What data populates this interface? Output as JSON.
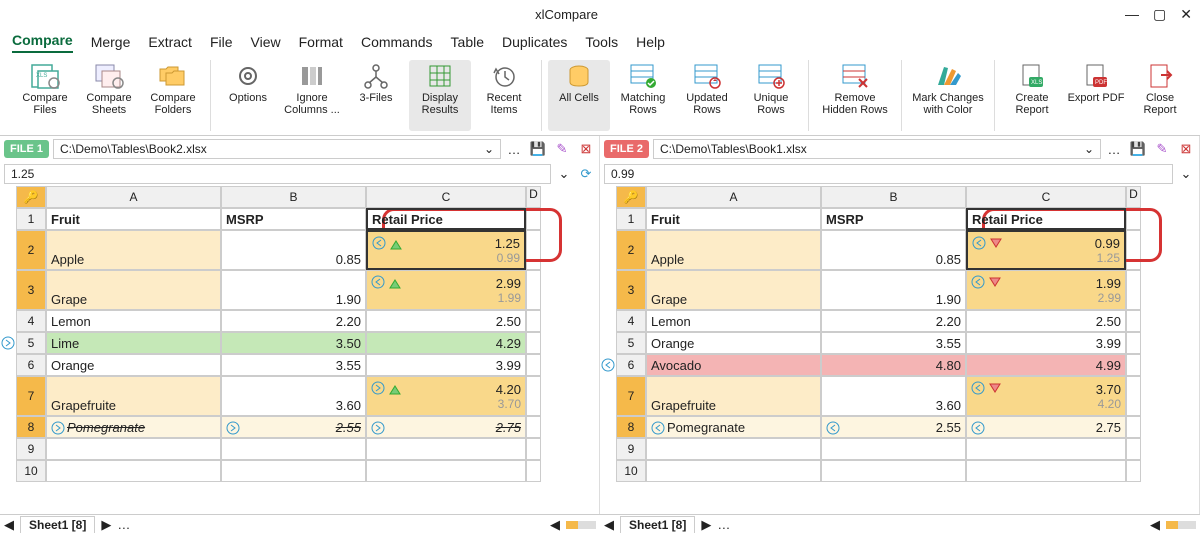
{
  "app_title": "xlCompare",
  "menu": [
    "Compare",
    "Merge",
    "Extract",
    "File",
    "View",
    "Format",
    "Commands",
    "Table",
    "Duplicates",
    "Tools",
    "Help"
  ],
  "ribbon": [
    {
      "key": "compare-files",
      "label": "Compare Files"
    },
    {
      "key": "compare-sheets",
      "label": "Compare Sheets"
    },
    {
      "key": "compare-folders",
      "label": "Compare Folders"
    },
    {
      "key": "options",
      "label": "Options"
    },
    {
      "key": "ignore-columns",
      "label": "Ignore Columns ..."
    },
    {
      "key": "three-files",
      "label": "3-Files"
    },
    {
      "key": "display-results",
      "label": "Display Results"
    },
    {
      "key": "recent-items",
      "label": "Recent Items"
    },
    {
      "key": "all-cells",
      "label": "All Cells"
    },
    {
      "key": "matching-rows",
      "label": "Matching Rows"
    },
    {
      "key": "updated-rows",
      "label": "Updated Rows"
    },
    {
      "key": "unique-rows",
      "label": "Unique Rows"
    },
    {
      "key": "remove-hidden",
      "label": "Remove Hidden Rows"
    },
    {
      "key": "mark-changes",
      "label": "Mark Changes with Color"
    },
    {
      "key": "create-report",
      "label": "Create Report"
    },
    {
      "key": "export-pdf",
      "label": "Export PDF"
    },
    {
      "key": "close-report",
      "label": "Close Report"
    }
  ],
  "left": {
    "badge": "FILE 1",
    "path": "C:\\Demo\\Tables\\Book2.xlsx",
    "formula": "1.25",
    "columns": [
      "A",
      "B",
      "C",
      "D"
    ],
    "headers": {
      "A": "Fruit",
      "B": "MSRP",
      "C": "Retail Price"
    },
    "rows": [
      {
        "n": 2,
        "A": "Apple",
        "B": "0.85",
        "C_new": "1.25",
        "C_old": "0.99",
        "changed": true,
        "diff": "up"
      },
      {
        "n": 3,
        "A": "Grape",
        "B": "1.90",
        "C_new": "2.99",
        "C_old": "1.99",
        "changed": true,
        "diff": "up"
      },
      {
        "n": 4,
        "A": "Lemon",
        "B": "2.20",
        "C": "2.50"
      },
      {
        "n": 5,
        "A": "Lime",
        "B": "3.50",
        "C": "4.29",
        "added": true
      },
      {
        "n": 6,
        "A": "Orange",
        "B": "3.55",
        "C": "3.99"
      },
      {
        "n": 7,
        "A": "Grapefruite",
        "B": "3.60",
        "C_new": "4.20",
        "C_old": "3.70",
        "changed": true,
        "diff": "up"
      },
      {
        "n": 8,
        "A": "Pomegranate",
        "B": "2.55",
        "C": "2.75",
        "strike": true,
        "changed": true
      },
      {
        "n": 9,
        "A": "",
        "B": "",
        "C": ""
      },
      {
        "n": 10,
        "A": "",
        "B": "",
        "C": ""
      }
    ],
    "sheet_tab": "Sheet1 [8]"
  },
  "right": {
    "badge": "FILE 2",
    "path": "C:\\Demo\\Tables\\Book1.xlsx",
    "formula": "0.99",
    "columns": [
      "A",
      "B",
      "C",
      "D"
    ],
    "headers": {
      "A": "Fruit",
      "B": "MSRP",
      "C": "Retail Price"
    },
    "rows": [
      {
        "n": 2,
        "A": "Apple",
        "B": "0.85",
        "C_new": "0.99",
        "C_old": "1.25",
        "changed": true,
        "diff": "down"
      },
      {
        "n": 3,
        "A": "Grape",
        "B": "1.90",
        "C_new": "1.99",
        "C_old": "2.99",
        "changed": true,
        "diff": "down"
      },
      {
        "n": 4,
        "A": "Lemon",
        "B": "2.20",
        "C": "2.50"
      },
      {
        "n": 5,
        "A": "Orange",
        "B": "3.55",
        "C": "3.99"
      },
      {
        "n": 6,
        "A": "Avocado",
        "B": "4.80",
        "C": "4.99",
        "removed": true
      },
      {
        "n": 7,
        "A": "Grapefruite",
        "B": "3.60",
        "C_new": "3.70",
        "C_old": "4.20",
        "changed": true,
        "diff": "down"
      },
      {
        "n": 8,
        "A": "Pomegranate",
        "B": "2.55",
        "C": "2.75",
        "changed": true,
        "light": true
      },
      {
        "n": 9,
        "A": "",
        "B": "",
        "C": ""
      },
      {
        "n": 10,
        "A": "",
        "B": "",
        "C": ""
      }
    ],
    "sheet_tab": "Sheet1 [8]"
  }
}
